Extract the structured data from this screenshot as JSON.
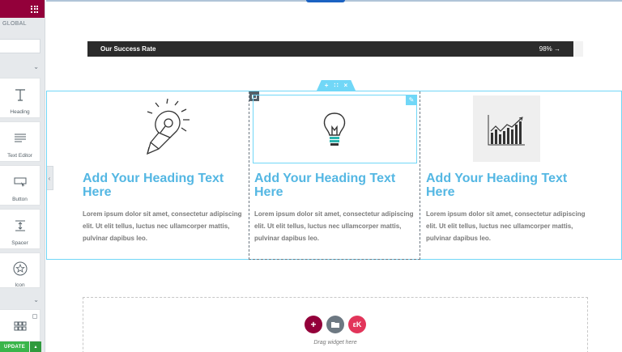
{
  "panel": {
    "tab_label": "GLOBAL",
    "widgets": [
      {
        "label": "Heading",
        "icon": "heading-icon"
      },
      {
        "label": "Text Editor",
        "icon": "text-editor-icon"
      },
      {
        "label": "Button",
        "icon": "button-icon"
      },
      {
        "label": "Spacer",
        "icon": "spacer-icon"
      },
      {
        "label": "Icon",
        "icon": "star-icon"
      },
      {
        "label": "",
        "icon": "gallery-icon"
      }
    ],
    "update_label": "UPDATE",
    "colors": {
      "header": "#93003a",
      "update": "#39b54a"
    }
  },
  "progress": {
    "label": "Our Success Rate",
    "value": "98%",
    "percent": 98
  },
  "columns": [
    {
      "heading": "Add Your Heading Text Here",
      "text": "Lorem ipsum dolor sit amet, consectetur adipiscing elit. Ut elit tellus, luctus nec ullamcorper mattis, pulvinar dapibus leo.",
      "image": "pencil-bulb-icon"
    },
    {
      "heading": "Add Your Heading Text Here",
      "text": "Lorem ipsum dolor sit amet, consectetur adipiscing elit. Ut elit tellus, luctus nec ullamcorper mattis, pulvinar dapibus leo.",
      "image": "lightbulb-icon"
    },
    {
      "heading": "Add Your Heading Text Here",
      "text": "Lorem ipsum dolor sit amet, consectetur adipiscing elit. Ut elit tellus, luctus nec ullamcorper mattis, pulvinar dapibus leo.",
      "image": "bar-chart-icon"
    }
  ],
  "dropzone": {
    "label": "Drag widget here",
    "colors": {
      "add": "#93003a",
      "template": "#6d7882",
      "kit": "#e2355a"
    }
  },
  "accent_color": "#71d7f7",
  "heading_color": "#54b7e3"
}
